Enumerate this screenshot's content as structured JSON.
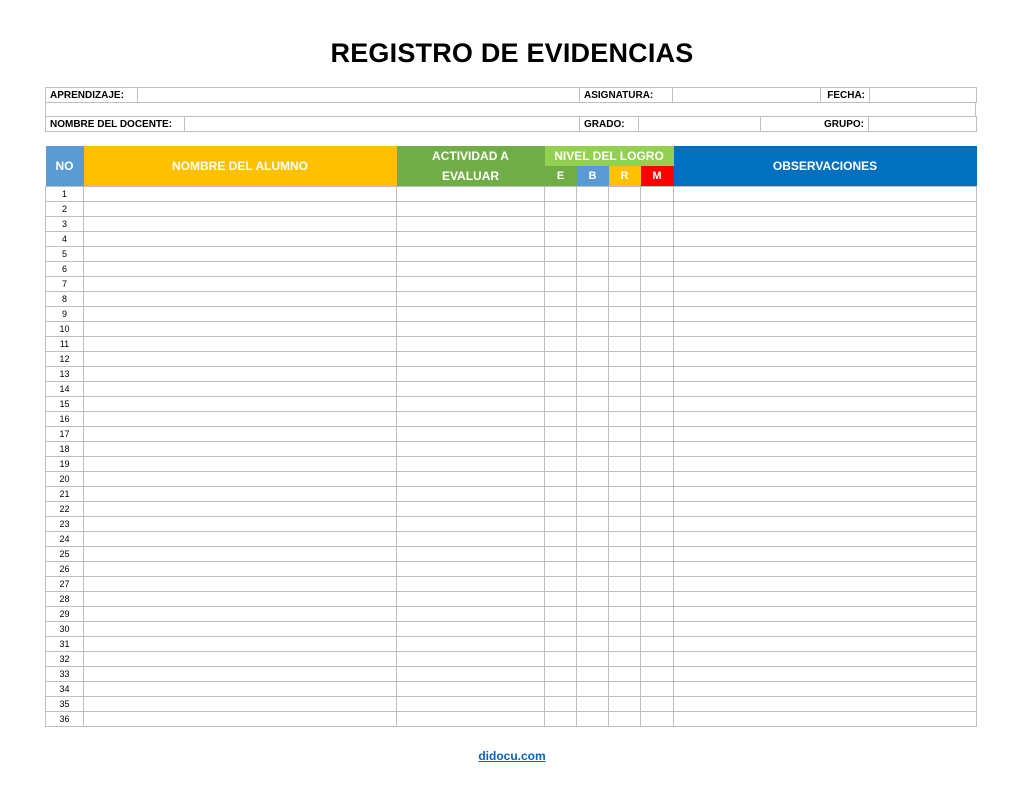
{
  "title": "REGISTRO DE EVIDENCIAS",
  "info": {
    "aprendizaje_label": "APRENDIZAJE:",
    "asignatura_label": "ASIGNATURA:",
    "fecha_label": "FECHA:",
    "docente_label": "NOMBRE DEL DOCENTE:",
    "grado_label": "GRADO:",
    "grupo_label": "GRUPO:"
  },
  "table": {
    "headers": {
      "no": "NO",
      "name": "NOMBRE DEL ALUMNO",
      "activity_line1": "ACTIVIDAD A",
      "activity_line2": "EVALUAR",
      "level": "NIVEL DEL LOGRO",
      "observations": "OBSERVACIONES"
    },
    "levels": [
      "E",
      "B",
      "R",
      "M"
    ],
    "rows": [
      1,
      2,
      3,
      4,
      5,
      6,
      7,
      8,
      9,
      10,
      11,
      12,
      13,
      14,
      15,
      16,
      17,
      18,
      19,
      20,
      21,
      22,
      23,
      24,
      25,
      26,
      27,
      28,
      29,
      30,
      31,
      32,
      33,
      34,
      35,
      36
    ]
  },
  "colors": {
    "no": "#5b9bd5",
    "name": "#ffc000",
    "activity": "#70ad47",
    "level": "#92d050",
    "observations": "#0070c0",
    "E": "#70ad47",
    "B": "#5b9bd5",
    "R": "#ffc000",
    "M": "#ff0000"
  },
  "footer": {
    "link": "didocu.com"
  }
}
